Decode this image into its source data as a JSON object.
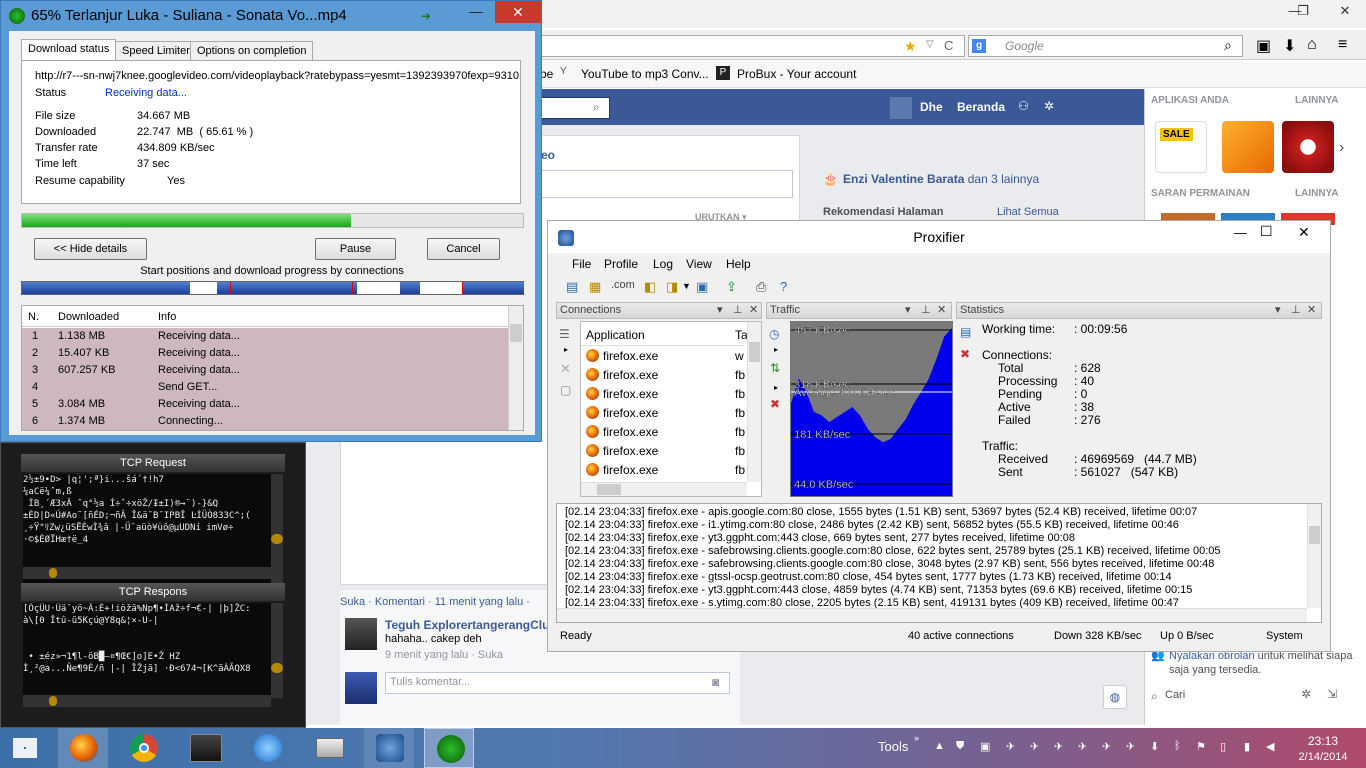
{
  "firefox": {
    "search_placeholder": "Google",
    "bookmarks": [
      "be",
      "YouTube to mp3 Conv...",
      "ProBux - Your account"
    ]
  },
  "facebook": {
    "user": "Dhe",
    "home": "Beranda",
    "sidebar_apps_title": "APLIKASI ANDA",
    "sidebar_more": "LAINNYA",
    "sidebar_games_title": "SARAN PERMAINAN",
    "sidebar_more2": "LAINNYA",
    "feed_header": "eo",
    "sort_label": "URUTKAN ▾",
    "birthday_text_name": "Enzi Valentine Barata",
    "birthday_text_rest": " dan 3 lainnya",
    "recommend_title": "Rekomendasi Halaman",
    "recommend_link": "Lihat Semua",
    "post_actions": "Suka · Komentari · 11 menit yang lalu ·",
    "comment_author": "Teguh ExplorertangerangClu",
    "comment_text": "hahaha.. cakep deh",
    "comment_meta": "9 menit yang lalu · Suka",
    "comment_placeholder": "Tulis komentar...",
    "chat_text_link": "Nyalakan obrolan",
    "chat_text_rest": " untuk melihat siapa saja yang tersedia.",
    "chat_search": "Cari"
  },
  "idm": {
    "title": "65% Terlanjur Luka - Suliana - Sonata Vo...mp4",
    "tabs": [
      "Download status",
      "Speed Limiter",
      "Options on completion"
    ],
    "url": "http://r7---sn-nwj7knee.googlevideo.com/videoplayback?ratebypass=yesmt=1392393970fexp=9310",
    "status_label": "Status",
    "status_value": "Receiving data...",
    "rows": [
      {
        "label": "File size",
        "value": "34.667  MB"
      },
      {
        "label": "Downloaded",
        "value": "22.747  MB  ( 65.61 % )"
      },
      {
        "label": "Transfer rate",
        "value": "434.809  KB/sec"
      },
      {
        "label": "Time left",
        "value": "37 sec"
      }
    ],
    "resume_label": "Resume capability",
    "resume_value": "Yes",
    "progress": 0.6561,
    "buttons": {
      "hide": "<< Hide details",
      "pause": "Pause",
      "cancel": "Cancel"
    },
    "conn_caption": "Start positions and download progress by connections",
    "table_headers": [
      "N.",
      "Downloaded",
      "Info"
    ],
    "connections": [
      {
        "n": "1",
        "dl": "1.138  MB",
        "info": "Receiving data..."
      },
      {
        "n": "2",
        "dl": "15.407  KB",
        "info": "Receiving data..."
      },
      {
        "n": "3",
        "dl": "607.257  KB",
        "info": "Receiving data..."
      },
      {
        "n": "4",
        "dl": "",
        "info": "Send GET..."
      },
      {
        "n": "5",
        "dl": "3.084  MB",
        "info": "Receiving data..."
      },
      {
        "n": "6",
        "dl": "1.374  MB",
        "info": "Connecting..."
      }
    ]
  },
  "tcp": {
    "request_title": "TCP Request",
    "request_text": "2½±9•D> |q¦';ª}i...šá´†!h7\n¼aCë¼ˆm,ß\n ÌB¸´Æ3xÂ ˆq°½a Í÷ˆ÷xöŽ/Ɨ±I)®→¨)-}&Q\n±ÈD|D«Ú#Ao˜[ñÉD;¬ñÂ Î&ä¯B¯IPBÎ ĿÍÜÒ833C^;(\n¸÷Ÿ°ﾘZw¿üSËÉwÌ¾â |-Ü¯aüò¥ùô@µUDNi imVø÷\n·©$ÉØÏHæ†ë_4",
    "response_title": "TCP Respons",
    "response_text": "[ÓçÜU·Üä¯yö~Ã:É+!iöžã%Np¶•ÌAž÷f¬€-| |þ]ŽC:\nà\\[0 Îtû-ü5Kçú@Y8q&¦×-U-|\n\n\n • ±éz»¬1¶l-öB█—¤¶Œ€]o]E•Ž HZ\nÌ¸²@a...Ñe¶9É/ñ |-| ÎŽjã] ·Ð<674¬[K^ãÀÃQX8"
  },
  "proxifier": {
    "title": "Proxifier",
    "menu": [
      "File",
      "Profile",
      "Log",
      "View",
      "Help"
    ],
    "panels": {
      "connections": "Connections",
      "traffic": "Traffic",
      "statistics": "Statistics"
    },
    "app_header": "Application",
    "app_header2": "Ta",
    "apps": [
      "firefox.exe",
      "firefox.exe",
      "firefox.exe",
      "firefox.exe",
      "firefox.exe",
      "firefox.exe",
      "firefox.exe"
    ],
    "app_col2": [
      "w",
      "fb",
      "fb",
      "fb",
      "fb",
      "fb",
      "fb"
    ],
    "traffic_labels": {
      "top": "457 KB/sec",
      "mid_hidden": "318 KB/sec",
      "avg": "Average 300 KB/sec",
      "l181": "181 KB/sec",
      "l44": "44.0 KB/sec"
    },
    "stats": {
      "working_time_label": "Working time:",
      "working_time": ": 00:09:56",
      "connections_label": "Connections:",
      "conn_rows": [
        {
          "label": "Total",
          "value": ": 628"
        },
        {
          "label": "Processing",
          "value": ": 40"
        },
        {
          "label": "Pending",
          "value": ": 0"
        },
        {
          "label": "Active",
          "value": ": 38"
        },
        {
          "label": "Failed",
          "value": ": 276"
        }
      ],
      "traffic_label": "Traffic:",
      "traffic_rows": [
        {
          "label": "Received",
          "value": ": 46969569   (44.7 MB)"
        },
        {
          "label": "Sent",
          "value": ": 561027   (547 KB)"
        }
      ]
    },
    "log": [
      "[02.14 23:04:33] firefox.exe - apis.google.com:80 close, 1555 bytes (1.51 KB) sent, 53697 bytes (52.4 KB) received, lifetime 00:07",
      "[02.14 23:04:33] firefox.exe - i1.ytimg.com:80 close, 2486 bytes (2.42 KB) sent, 56852 bytes (55.5 KB) received, lifetime 00:46",
      "[02.14 23:04:33] firefox.exe - yt3.ggpht.com:443 close, 669 bytes sent, 277 bytes received, lifetime 00:08",
      "[02.14 23:04:33] firefox.exe - safebrowsing.clients.google.com:80 close, 622 bytes sent, 25789 bytes (25.1 KB) received, lifetime 00:05",
      "[02.14 23:04:33] firefox.exe - safebrowsing.clients.google.com:80 close, 3048 bytes (2.97 KB) sent, 556 bytes received, lifetime 00:48",
      "[02.14 23:04:33] firefox.exe - gtssl-ocsp.geotrust.com:80 close, 454 bytes sent, 1777 bytes (1.73 KB) received, lifetime 00:14",
      "[02.14 23:04:33] firefox.exe - yt3.ggpht.com:443 close, 4859 bytes (4.74 KB) sent, 71353 bytes (69.6 KB) received, lifetime 00:15",
      "[02.14 23:04:33] firefox.exe - s.ytimg.com:80 close, 2205 bytes (2.15 KB) sent, 419131 bytes (409 KB) received, lifetime 00:47"
    ],
    "status": {
      "ready": "Ready",
      "active": "40 active connections",
      "down": "Down 328 KB/sec",
      "up": "Up 0 B/sec",
      "system": "System"
    }
  },
  "taskbar": {
    "tools": "Tools",
    "time": "23:13",
    "date": "2/14/2014"
  }
}
